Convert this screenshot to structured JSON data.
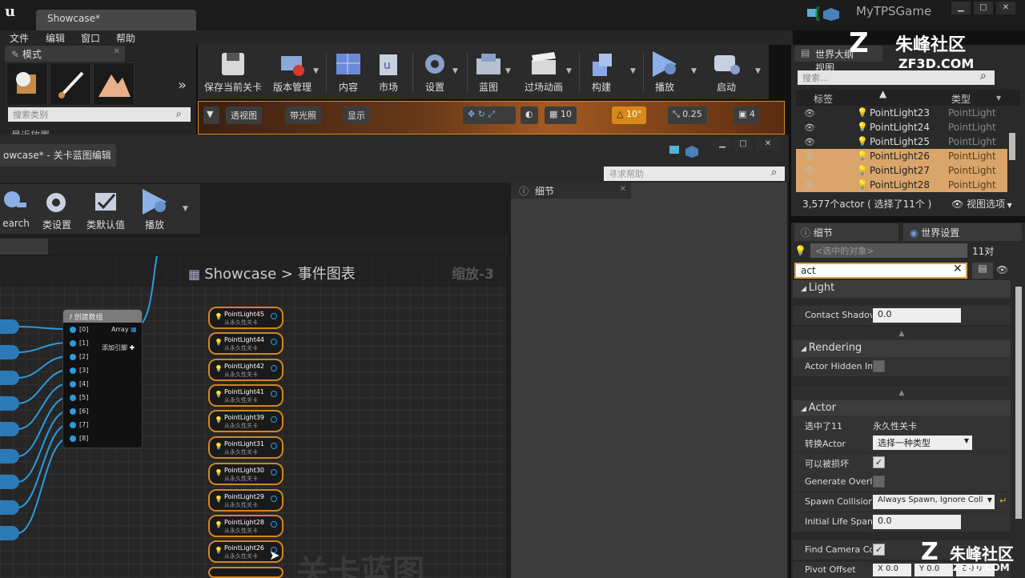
{
  "window": {
    "doc_tab": "Showcase*",
    "project_name": "MyTPSGame",
    "min": "▁",
    "max": "□",
    "close": "✕"
  },
  "menu": [
    "文件",
    "编辑",
    "窗口",
    "帮助"
  ],
  "modes": {
    "title": "模式",
    "search_placeholder": "搜索类别",
    "recent_label": "最近放置"
  },
  "toolbar": [
    {
      "label": "保存当前关卡",
      "icon": "save-icon"
    },
    {
      "label": "版本管理",
      "icon": "source-control-icon"
    },
    {
      "label": "内容",
      "icon": "content-icon"
    },
    {
      "label": "市场",
      "icon": "marketplace-icon"
    },
    {
      "label": "设置",
      "icon": "settings-icon"
    },
    {
      "label": "蓝图",
      "icon": "blueprint-icon"
    },
    {
      "label": "过场动画",
      "icon": "cinematics-icon"
    },
    {
      "label": "构建",
      "icon": "build-icon"
    },
    {
      "label": "播放",
      "icon": "play-icon"
    },
    {
      "label": "启动",
      "icon": "launch-icon"
    }
  ],
  "viewport": {
    "perspective": "透视图",
    "lit": "带光照",
    "show": "显示",
    "grid_snap": "10",
    "rot_snap": "10°",
    "scale_snap": "0.25",
    "camera_speed": "4"
  },
  "blueprint": {
    "tab_title": "owcase* - 关卡蓝图编辑",
    "help_search": "寻求帮助",
    "toolbar": [
      {
        "label": "earch",
        "icon": "search-icon"
      },
      {
        "label": "类设置",
        "icon": "class-settings-icon"
      },
      {
        "label": "类默认值",
        "icon": "class-defaults-icon"
      },
      {
        "label": "播放",
        "icon": "play-icon"
      }
    ],
    "crumb_root": "Showcase",
    "crumb_sep": ">",
    "crumb_graph": "事件图表",
    "zoom": "缩放-3",
    "watermark": "关卡蓝图",
    "array_node": {
      "title": "创建数组",
      "output": "Array",
      "add_pin": "添加引脚",
      "pins": [
        "[0]",
        "[1]",
        "[2]",
        "[3]",
        "[4]",
        "[5]",
        "[6]",
        "[7]",
        "[8]"
      ]
    },
    "light_nodes": [
      {
        "name": "PointLight45",
        "sub": "从永久性关卡"
      },
      {
        "name": "PointLight44",
        "sub": "从永久性关卡"
      },
      {
        "name": "PointLight42",
        "sub": "从永久性关卡"
      },
      {
        "name": "PointLight41",
        "sub": "从永久性关卡"
      },
      {
        "name": "PointLight39",
        "sub": "从永久性关卡"
      },
      {
        "name": "PointLight31",
        "sub": "从永久性关卡"
      },
      {
        "name": "PointLight30",
        "sub": "从永久性关卡"
      },
      {
        "name": "PointLight29",
        "sub": "从永久性关卡"
      },
      {
        "name": "PointLight28",
        "sub": "从永久性关卡"
      },
      {
        "name": "PointLight26",
        "sub": "从永久性关卡"
      }
    ]
  },
  "mid_details": {
    "title": "细节"
  },
  "outliner": {
    "title": "世界大纲视图",
    "search_placeholder": "搜索...",
    "col_label": "标签",
    "col_type": "类型",
    "rows": [
      {
        "name": "PointLight23",
        "type": "PointLight",
        "selected": false
      },
      {
        "name": "PointLight24",
        "type": "PointLight",
        "selected": false
      },
      {
        "name": "PointLight25",
        "type": "PointLight",
        "selected": false
      },
      {
        "name": "PointLight26",
        "type": "PointLight",
        "selected": true
      },
      {
        "name": "PointLight27",
        "type": "PointLight",
        "selected": true
      },
      {
        "name": "PointLight28",
        "type": "PointLight",
        "selected": true
      }
    ],
    "footer": "3,577个actor ( 选择了11个 )",
    "view_options": "视图选项"
  },
  "details": {
    "tab_details": "细节",
    "tab_world": "世界设置",
    "object_field": "<选中的对象>",
    "count": "11对‍",
    "filter": "act",
    "categories": {
      "light": "Light",
      "rendering": "Rendering",
      "actor": "Actor"
    },
    "props": {
      "contact_shadow": {
        "label": "Contact Shadov",
        "value": "0.0"
      },
      "actor_hidden": {
        "label": "Actor Hidden In"
      },
      "selected": {
        "label": "选中了11",
        "value": "永久性关卡"
      },
      "convert": {
        "label": "转换Actor",
        "value": "选择一种类型"
      },
      "destructible": {
        "label": "可以被损坏"
      },
      "gen_overlap": {
        "label": "Generate Overl‍"
      },
      "spawn": {
        "label": "Spawn Collision",
        "value": "Always Spawn, Ignore Coll"
      },
      "lifespan": {
        "label": "Initial Life Span",
        "value": "0.0"
      },
      "find_camera": {
        "label": "Find Camera Co"
      },
      "pivot": {
        "label": "Pivot Offset",
        "x": "X 0.0",
        "y": "Y 0.0",
        "z": "Z 0.0"
      }
    }
  },
  "watermarks": {
    "top": "朱峰社区",
    "top_sub": "ZF3D.COM",
    "bottom": "朱峰社区",
    "bottom_sub": "ZF3D.COM"
  }
}
